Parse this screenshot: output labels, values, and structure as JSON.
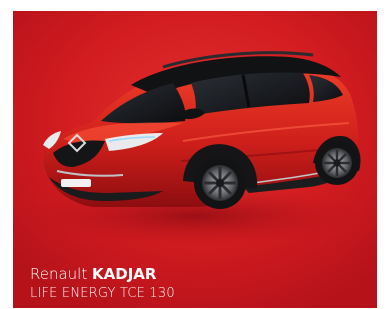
{
  "product": {
    "brand": "Renault",
    "model": "KADJAR",
    "trim": "LIFE ENERGY TCE 130"
  },
  "image": {
    "subject": "car-photo",
    "vehicle_color": "#c8191c",
    "roof_color": "#151515",
    "background_color": "#d41f22"
  }
}
